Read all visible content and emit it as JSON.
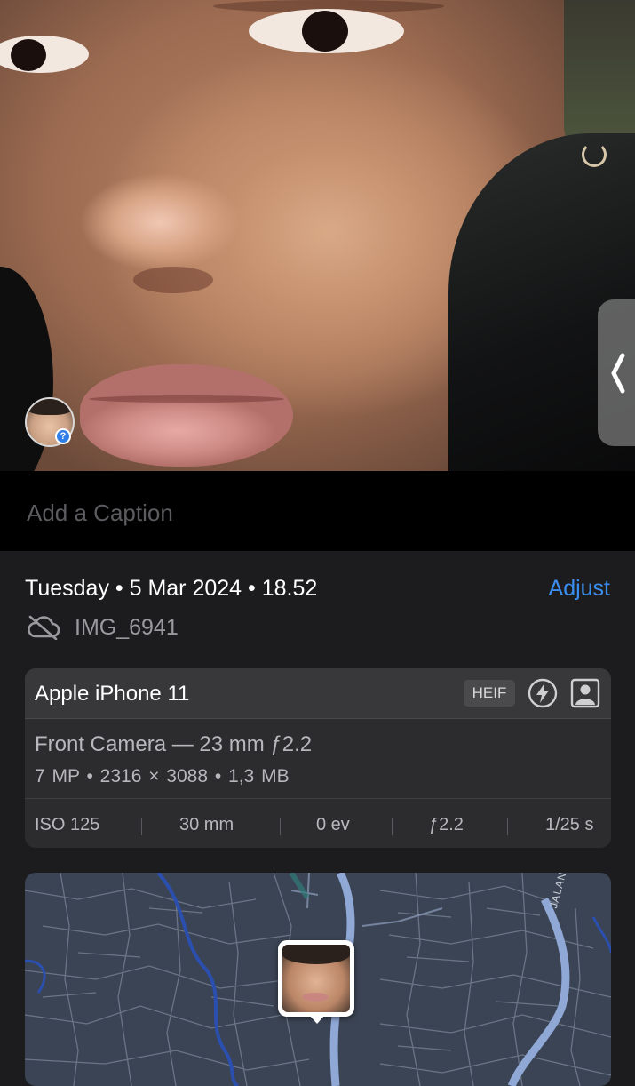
{
  "caption": {
    "placeholder": "Add a Caption"
  },
  "info": {
    "datetime": "Tuesday • 5 Mar 2024 • 18.52",
    "adjust_label": "Adjust",
    "filename": "IMG_6941",
    "cloud_icon": "cloud-slash-icon"
  },
  "camera": {
    "device": "Apple iPhone 11",
    "format": "HEIF",
    "lens": "Front Camera — 23 mm ƒ2.2",
    "specs": "7 MP • 2316 × 3088 • 1,3 MB",
    "exif": {
      "iso": "ISO 125",
      "focal": "30 mm",
      "ev": "0 ev",
      "aperture": "ƒ2.2",
      "shutter": "1/25 s"
    },
    "icons": [
      "flash-icon",
      "portrait-icon"
    ]
  },
  "map": {
    "street_label": "JALAN T"
  },
  "colors": {
    "background": "#1c1c1e",
    "caption_bg": "#000000",
    "card_bg": "#2c2c2e",
    "accent_blue": "#3b8ef0",
    "map_bg": "#3b4454",
    "road": "#8fa8d6",
    "water": "#2b4fae"
  }
}
